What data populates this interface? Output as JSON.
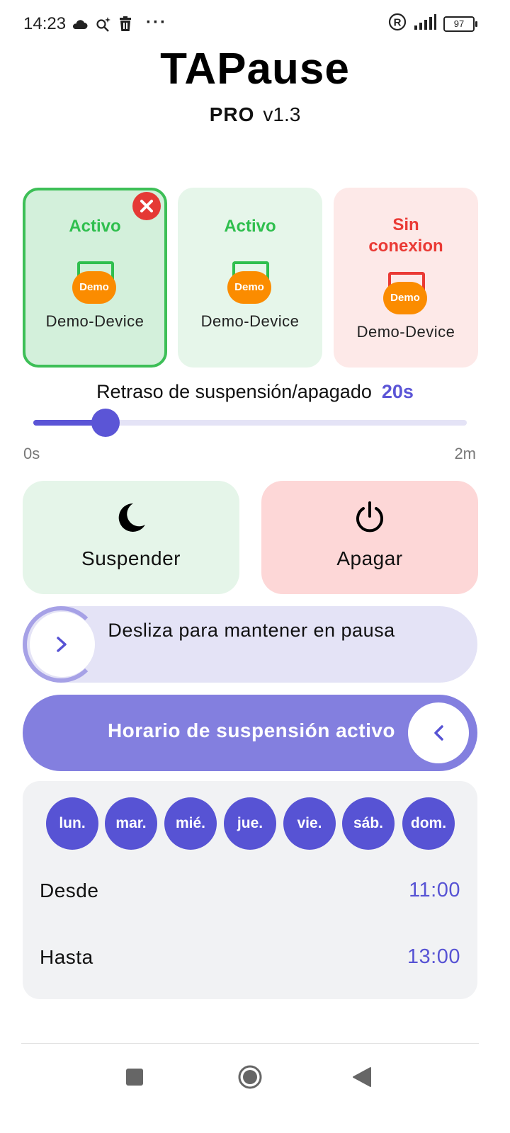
{
  "status_bar": {
    "time": "14:23",
    "icons": [
      "cloud-icon",
      "sparkle-search-icon",
      "trash-icon",
      "more-dots-icon",
      "registered-icon",
      "signal-icon",
      "battery-icon"
    ],
    "more": "···",
    "battery_level": "97"
  },
  "header": {
    "title": "TAPause",
    "tier": "PRO",
    "version": "v1.3"
  },
  "devices": [
    {
      "status": "Activo",
      "badge": "Demo",
      "name": "Demo-Device",
      "state": "active",
      "selected": true
    },
    {
      "status": "Activo",
      "badge": "Demo",
      "name": "Demo-Device",
      "state": "active",
      "selected": false
    },
    {
      "status": "Sin conexion",
      "badge": "Demo",
      "name": "Demo-Device",
      "state": "offline",
      "selected": false
    }
  ],
  "delay": {
    "label": "Retraso de suspensión/apagado",
    "value": "20s",
    "min_label": "0s",
    "max_label": "2m",
    "fraction": 0.1667
  },
  "actions": {
    "suspend_label": "Suspender",
    "shutdown_label": "Apagar"
  },
  "swipe_pause": {
    "label": "Desliza para mantener en pausa"
  },
  "schedule": {
    "toggle_label": "Horario de suspensión activo",
    "days": [
      "lun.",
      "mar.",
      "mié.",
      "jue.",
      "vie.",
      "sáb.",
      "dom."
    ],
    "from_label": "Desde",
    "from_value": "11:00",
    "to_label": "Hasta",
    "to_value": "13:00"
  },
  "colors": {
    "accent": "#5b55d6",
    "active_green": "#2fbf4e",
    "offline_red": "#ea3a35",
    "demo_orange": "#fb8c00"
  }
}
